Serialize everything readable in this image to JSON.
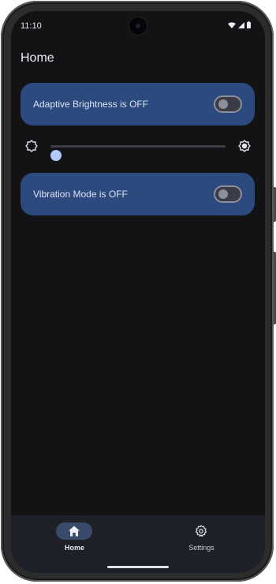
{
  "status_bar": {
    "time": "11:10",
    "icons": [
      "wifi-icon",
      "cellular-signal-icon",
      "battery-icon"
    ]
  },
  "header": {
    "title": "Home"
  },
  "settings": {
    "adaptive_brightness": {
      "label": "Adaptive Brightness is OFF",
      "enabled": false
    },
    "brightness_slider": {
      "min_icon": "brightness-low-icon",
      "max_icon": "brightness-high-icon",
      "value": 0
    },
    "vibration_mode": {
      "label": "Vibration Mode is OFF",
      "enabled": false
    }
  },
  "bottom_nav": {
    "items": [
      {
        "label": "Home",
        "icon": "home-icon",
        "active": true
      },
      {
        "label": "Settings",
        "icon": "gear-icon",
        "active": false
      }
    ]
  },
  "colors": {
    "background": "#131316",
    "card": "#2c4a7e",
    "accent": "#aec6ff",
    "nav_background": "#1e2027",
    "nav_active_pill": "#3a4a6a"
  }
}
